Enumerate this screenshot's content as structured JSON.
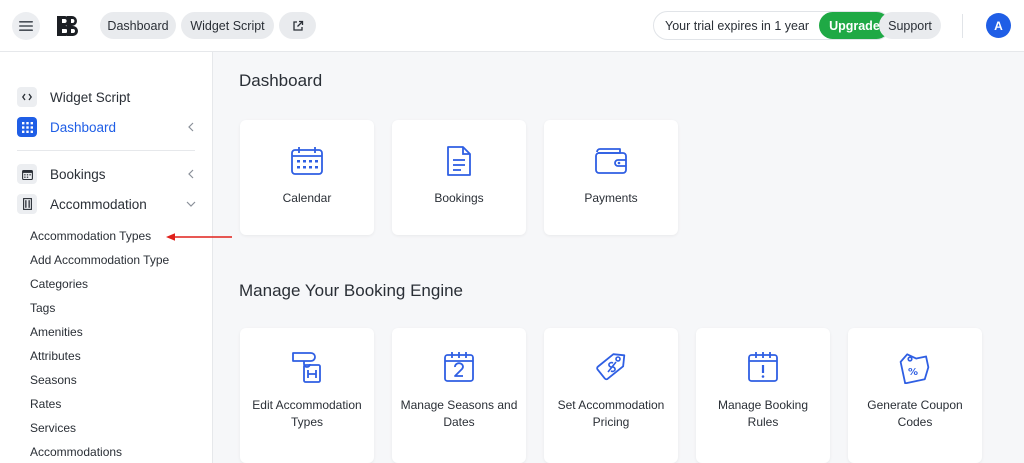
{
  "header": {
    "nav": [
      {
        "label": "Dashboard"
      },
      {
        "label": "Widget Script"
      }
    ],
    "trial_text": "Your trial expires in 1 year",
    "upgrade_label": "Upgrade",
    "support_label": "Support",
    "avatar_initial": "A",
    "icons": {
      "menu": "hamburger-icon",
      "external": "external-link-icon",
      "logo": "bb-logo"
    }
  },
  "sidebar": {
    "items": [
      {
        "label": "Widget Script",
        "icon": "code-icon",
        "active": false
      },
      {
        "label": "Dashboard",
        "icon": "grid-icon",
        "active": true,
        "chevron": "chevron-left-icon"
      },
      {
        "label": "Bookings",
        "icon": "calendar-icon",
        "active": false,
        "chevron": "chevron-left-icon"
      },
      {
        "label": "Accommodation",
        "icon": "building-icon",
        "active": false,
        "chevron": "chevron-down-icon"
      }
    ],
    "submenu": [
      "Accommodation Types",
      "Add Accommodation Type",
      "Categories",
      "Tags",
      "Amenities",
      "Attributes",
      "Seasons",
      "Rates",
      "Services",
      "Accommodations"
    ]
  },
  "main": {
    "title": "Dashboard",
    "cards": [
      {
        "label": "Calendar",
        "icon": "calendar-icon"
      },
      {
        "label": "Bookings",
        "icon": "document-icon"
      },
      {
        "label": "Payments",
        "icon": "wallet-icon"
      }
    ],
    "manage_title": "Manage Your Booking Engine",
    "manage_cards": [
      {
        "label": "Edit Accommodation Types",
        "icon": "hotel-sign-icon"
      },
      {
        "label": "Manage Seasons and Dates",
        "icon": "calendar-date-icon"
      },
      {
        "label": "Set Accommodation Pricing",
        "icon": "price-tag-icon"
      },
      {
        "label": "Manage Booking Rules",
        "icon": "calendar-alert-icon"
      },
      {
        "label": "Generate Coupon Codes",
        "icon": "coupon-icon"
      }
    ]
  },
  "colors": {
    "accent": "#1f5ee6",
    "upgrade": "#1fa945",
    "annotation_arrow": "#e0201b"
  }
}
